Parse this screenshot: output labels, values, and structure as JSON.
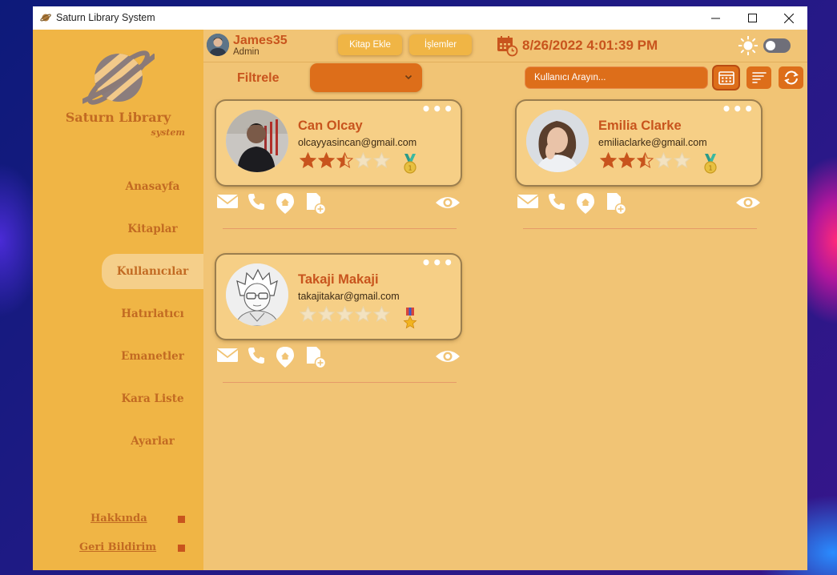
{
  "window": {
    "title": "Saturn Library System"
  },
  "sidebar": {
    "brand": "Saturn Library",
    "brand_sub": "system",
    "nav": [
      {
        "label": "Anasayfa"
      },
      {
        "label": "Kitaplar"
      },
      {
        "label": "Kullanıcılar",
        "active": true
      },
      {
        "label": "Hatırlatıcı"
      },
      {
        "label": "Emanetler"
      },
      {
        "label": "Kara Liste"
      },
      {
        "label": "Ayarlar"
      }
    ],
    "footer": [
      {
        "label": "Hakkında"
      },
      {
        "label": "Geri Bildirim"
      }
    ]
  },
  "topbar": {
    "user": {
      "name": "James35",
      "role": "Admin"
    },
    "add_book_label": "Kitap Ekle",
    "operations_label": "İşlemler",
    "datetime": "8/26/2022 4:01:39 PM",
    "dark_mode": false
  },
  "toolbar": {
    "filter_label": "Filtrele",
    "filter_value": "",
    "search_placeholder": "Kullanıcı Arayın..."
  },
  "users": [
    {
      "name": "Can Olcay",
      "email": "olcayyasincan@gmail.com",
      "rating": 2.5,
      "max_rating": 5,
      "medal": "green"
    },
    {
      "name": "Emilia Clarke",
      "email": "emiliaclarke@gmail.com",
      "rating": 2.5,
      "max_rating": 5,
      "medal": "green"
    },
    {
      "name": "Takaji Makaji",
      "email": "takajitakar@gmail.com",
      "rating": 0,
      "max_rating": 5,
      "medal": "red"
    }
  ],
  "colors": {
    "accent": "#dd6e1a",
    "text_orange": "#c8541d",
    "sidebar": "#f0b545",
    "content": "#f1c475",
    "star_filled": "#c8541d",
    "star_empty": "#f3e2c0"
  }
}
